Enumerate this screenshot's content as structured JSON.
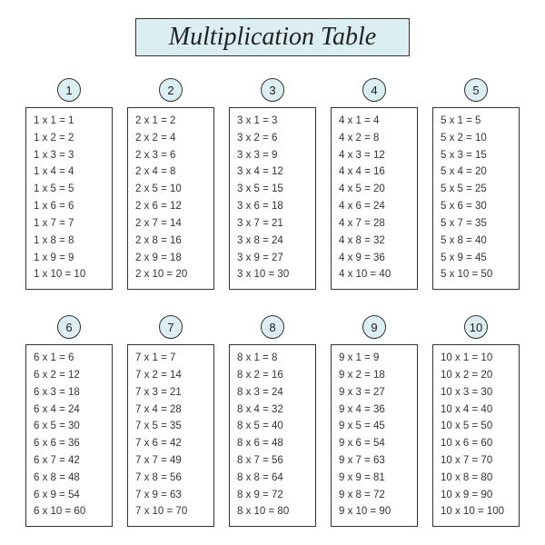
{
  "title": "Multiplication Table",
  "tables": [
    {
      "n": 1,
      "rows": [
        "1 x 1 = 1",
        "1 x 2 = 2",
        "1 x 3 = 3",
        "1 x 4 = 4",
        "1 x 5 = 5",
        "1 x 6 = 6",
        "1 x 7 = 7",
        "1 x 8 = 8",
        "1 x 9 = 9",
        "1 x 10 = 10"
      ]
    },
    {
      "n": 2,
      "rows": [
        "2 x 1 = 2",
        "2 x 2 = 4",
        "2 x 3 = 6",
        "2 x 4 = 8",
        "2 x 5 = 10",
        "2 x 6 = 12",
        "2 x 7 = 14",
        "2 x 8 = 16",
        "2 x 9 = 18",
        "2 x 10 = 20"
      ]
    },
    {
      "n": 3,
      "rows": [
        "3 x 1 = 3",
        "3 x 2 = 6",
        "3 x 3 = 9",
        "3 x 4 = 12",
        "3 x 5 = 15",
        "3 x 6 = 18",
        "3 x 7 = 21",
        "3 x 8 = 24",
        "3 x 9 = 27",
        "3 x 10 = 30"
      ]
    },
    {
      "n": 4,
      "rows": [
        "4 x 1 = 4",
        "4 x 2 = 8",
        "4 x 3 = 12",
        "4 x 4 = 16",
        "4 x 5 = 20",
        "4 x 6 = 24",
        "4 x 7 = 28",
        "4 x 8 = 32",
        "4 x 9 = 36",
        "4 x 10 = 40"
      ]
    },
    {
      "n": 5,
      "rows": [
        "5 x 1 = 5",
        "5 x 2 = 10",
        "5 x 3 = 15",
        "5 x 4 = 20",
        "5 x 5 = 25",
        "5 x 6 = 30",
        "5 x 7 = 35",
        "5 x 8 = 40",
        "5 x 9 = 45",
        "5 x 10 = 50"
      ]
    },
    {
      "n": 6,
      "rows": [
        "6 x 1 = 6",
        "6 x 2 = 12",
        "6 x 3 = 18",
        "6 x 4 = 24",
        "6 x 5 = 30",
        "6 x 6 = 36",
        "6 x 7 = 42",
        "6 x 8 = 48",
        "6 x 9 = 54",
        "6 x 10 = 60"
      ]
    },
    {
      "n": 7,
      "rows": [
        "7 x 1 = 7",
        "7 x 2 = 14",
        "7 x 3 = 21",
        "7 x 4 = 28",
        "7 x 5 = 35",
        "7 x 6 = 42",
        "7 x 7 = 49",
        "7 x 8 = 56",
        "7 x 9 = 63",
        "7 x 10 = 70"
      ]
    },
    {
      "n": 8,
      "rows": [
        "8 x 1 = 8",
        "8 x 2 = 16",
        "8 x 3 = 24",
        "8 x 4 = 32",
        "8 x 5 = 40",
        "8 x 6 = 48",
        "8 x 7 = 56",
        "8 x 8 = 64",
        "8 x 9 = 72",
        "8 x 10 = 80"
      ]
    },
    {
      "n": 9,
      "rows": [
        "9 x 1 = 9",
        "9 x 2 = 18",
        "9 x 3 = 27",
        "9 x 4 = 36",
        "9 x 5 = 45",
        "9 x 6 = 54",
        "9 x 7 = 63",
        "9 x 8 = 72",
        "9 x 9 = 81",
        "9 x 10 = 90"
      ]
    },
    {
      "n": 10,
      "rows": [
        "10 x 1 = 10",
        "10 x 2 = 20",
        "10 x 3 = 30",
        "10 x 4 = 40",
        "10 x 5 = 50",
        "10 x 6 = 60",
        "10 x 7 = 70",
        "10 x 8 = 80",
        "10 x 9 = 90",
        "10 x 10 = 100"
      ]
    }
  ]
}
